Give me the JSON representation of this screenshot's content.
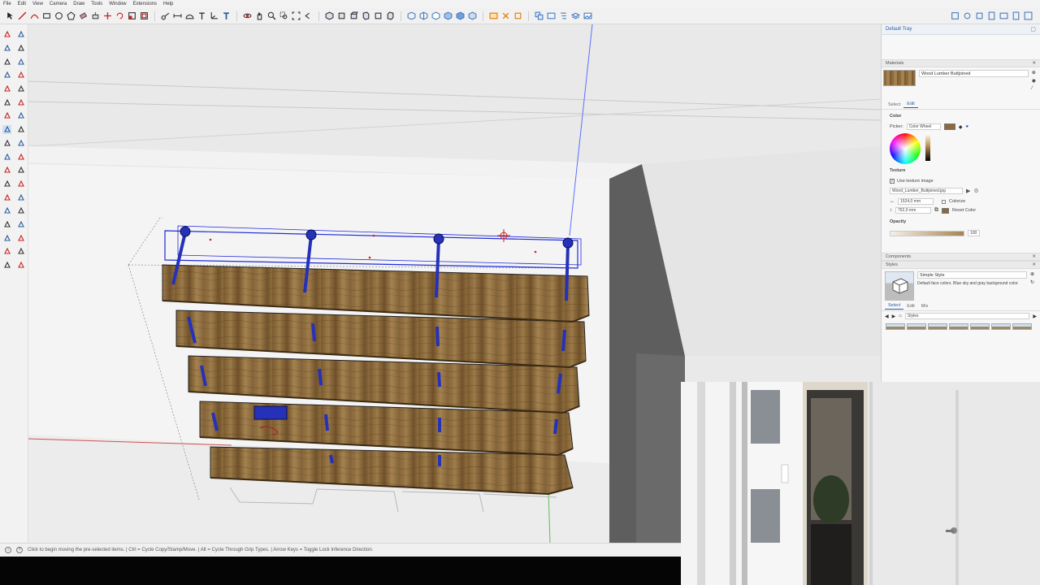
{
  "menu": [
    "File",
    "Edit",
    "View",
    "Camera",
    "Draw",
    "Tools",
    "Window",
    "Extensions",
    "Help"
  ],
  "status": {
    "text": "Click to begin moving the pre-selected items.  |  Ctrl = Cycle Copy/Stamp/Move.  |  Alt = Cycle Through Grip Types.  |  Arrow Keys = Toggle Lock Inference Direction."
  },
  "tray": {
    "title": "Default Tray",
    "materials": {
      "header": "Materials",
      "name": "Wood Lumber Buttjoined",
      "tabs": [
        "Select",
        "Edit"
      ],
      "color_label": "Color",
      "picker_label": "Picker:",
      "picker_value": "Color Wheel",
      "texture_label": "Texture",
      "use_texture": "Use texture image",
      "texture_file": "Wood_Lumber_Buttjoined.jpg",
      "width_value": "1524,0 mm",
      "height_value": "762,0 mm",
      "colorize": "Colorize",
      "reset_color": "Reset Color",
      "opacity_label": "Opacity",
      "opacity_value": "100"
    },
    "components": {
      "header": "Components"
    },
    "styles": {
      "header": "Styles",
      "name": "Simple Style",
      "description": "Default face colors. Blue sky and gray background color.",
      "tabs": [
        "Select",
        "Edit",
        "Mix"
      ],
      "dropdown": "Styles"
    }
  },
  "colors": {
    "accent": "#2a5d9f",
    "selection": "#1f2bd6",
    "wood": "#8b6a3e"
  }
}
